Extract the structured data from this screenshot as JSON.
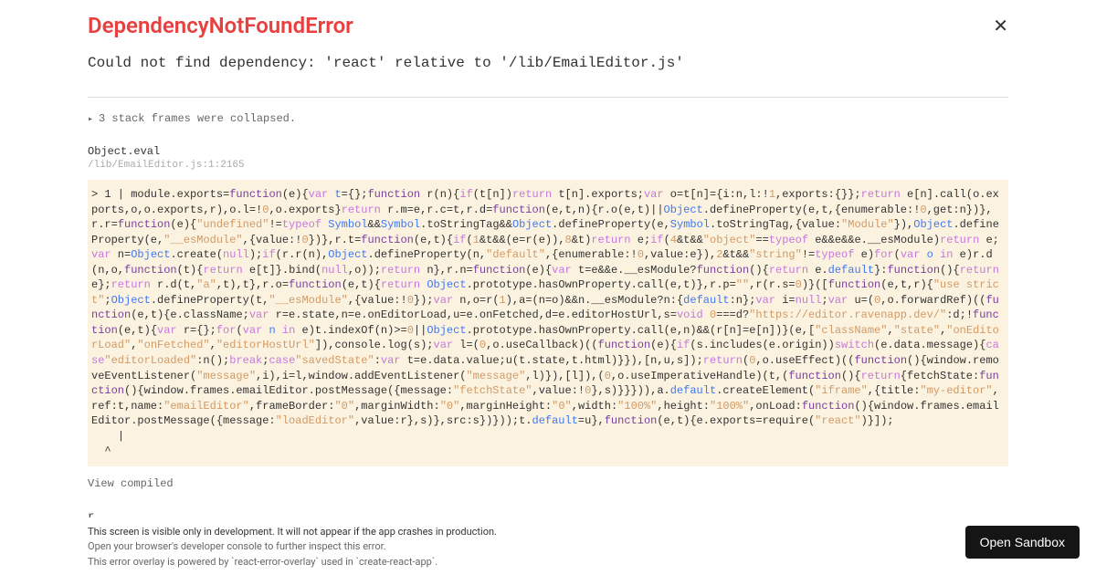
{
  "error": {
    "title": "DependencyNotFoundError",
    "message": "Could not find dependency: 'react' relative to '/lib/EmailEditor.js'"
  },
  "stack": {
    "collapsed": "3 stack frames were collapsed.",
    "location": "Object.eval",
    "file": "/lib/EmailEditor.js:1:2165",
    "view_compiled": "View compiled",
    "next_frame": "r"
  },
  "footer": {
    "line1": "This screen is visible only in development. It will not appear if the app crashes in production.",
    "line2": "Open your browser's developer console to further inspect this error.",
    "line3": "This error overlay is powered by `react-error-overlay` used in `create-react-app`."
  },
  "buttons": {
    "open_sandbox": "Open Sandbox"
  }
}
